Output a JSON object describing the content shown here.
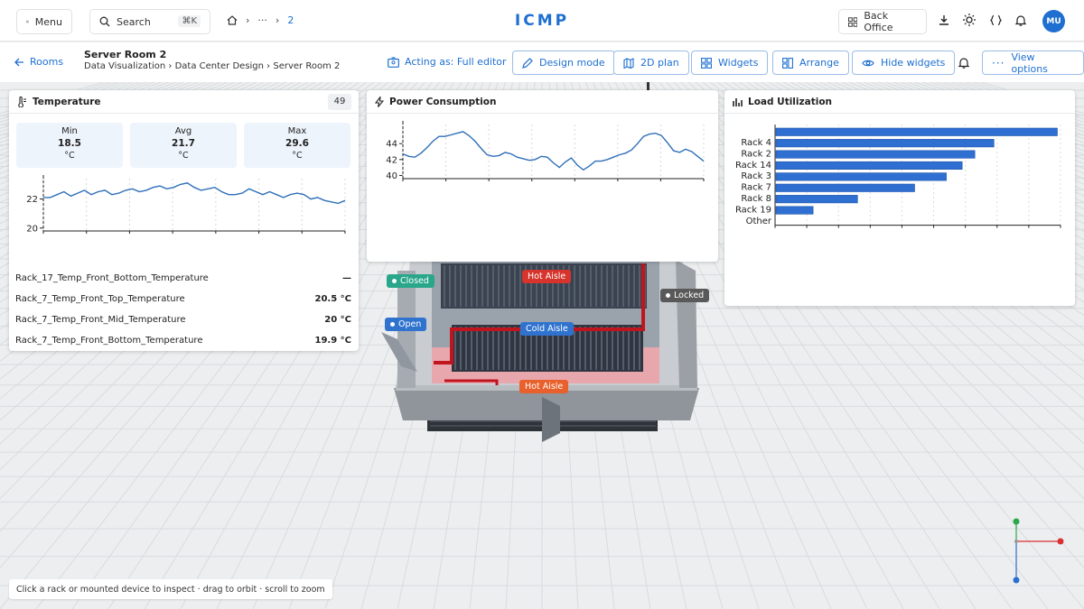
{
  "topbar": {
    "menu_label": "Menu",
    "search_label": "Search",
    "search_shortcut": "⌘K",
    "breadcrumb_ellipsis": "···",
    "breadcrumb_current": "2",
    "brand": "ICMP",
    "back_office_label": "Back Office",
    "avatar_initials": "MU"
  },
  "subheader": {
    "back_label": "Rooms",
    "room_title": "Server Room 2",
    "breadcrumb": "Data Visualization › Data Center Design › Server Room 2",
    "acting_as": "Acting as: Full editor",
    "buttons": {
      "design_mode": "Design mode",
      "plan_2d": "2D plan",
      "widgets": "Widgets",
      "arrange": "Arrange",
      "hide_widgets": "Hide widgets",
      "view_options": "View options"
    }
  },
  "temperature": {
    "title": "Temperature",
    "badge": "49",
    "stats": [
      {
        "label": "Min",
        "value": "18.5",
        "unit": "°C"
      },
      {
        "label": "Avg",
        "value": "21.7",
        "unit": "°C"
      },
      {
        "label": "Max",
        "value": "29.6",
        "unit": "°C"
      }
    ],
    "rows": [
      {
        "name": "Rack_17_Temp_Front_Bottom_Temperature",
        "value": "—"
      },
      {
        "name": "Rack_7_Temp_Front_Top_Temperature",
        "value": "20.5 °C"
      },
      {
        "name": "Rack_7_Temp_Front_Mid_Temperature",
        "value": "20 °C"
      },
      {
        "name": "Rack_7_Temp_Front_Bottom_Temperature",
        "value": "19.9 °C"
      }
    ]
  },
  "power": {
    "title": "Power Consumption"
  },
  "load": {
    "title": "Load Utilization"
  },
  "chart_data": [
    {
      "type": "line",
      "yticks": [
        20,
        22
      ],
      "ylim": [
        19.8,
        23.4
      ],
      "values": [
        22.1,
        22.1,
        22.3,
        22.5,
        22.2,
        22.4,
        22.6,
        22.3,
        22.5,
        22.6,
        22.3,
        22.4,
        22.6,
        22.7,
        22.5,
        22.6,
        22.8,
        22.9,
        22.7,
        22.8,
        23.0,
        23.1,
        22.8,
        22.6,
        22.7,
        22.8,
        22.5,
        22.3,
        22.3,
        22.4,
        22.7,
        22.5,
        22.3,
        22.5,
        22.3,
        22.1,
        22.3,
        22.4,
        22.3,
        22.0,
        22.1,
        21.9,
        21.8,
        21.7,
        21.9
      ],
      "color": "#2f6fb8"
    },
    {
      "type": "line",
      "yticks": [
        40,
        42,
        44
      ],
      "ylim": [
        39.6,
        46.4
      ],
      "values": [
        42.7,
        42.4,
        42.3,
        42.8,
        43.5,
        44.3,
        44.9,
        44.9,
        45.1,
        45.3,
        45.5,
        45.0,
        44.3,
        43.4,
        42.6,
        42.4,
        42.5,
        42.9,
        42.7,
        42.3,
        42.1,
        41.9,
        42.0,
        42.4,
        42.3,
        41.6,
        41.0,
        41.7,
        42.2,
        41.3,
        40.7,
        41.2,
        41.8,
        41.8,
        42.0,
        42.3,
        42.6,
        42.8,
        43.2,
        44.0,
        44.9,
        45.2,
        45.3,
        45.0,
        44.1,
        43.1,
        42.9,
        43.3,
        43.0,
        42.4,
        41.8
      ]
    },
    {
      "type": "bar",
      "orientation": "horizontal",
      "categories": [
        "Rack 4",
        "Rack 2",
        "Rack 14",
        "Rack 3",
        "Rack 7",
        "Rack 8",
        "Rack 19",
        "Other"
      ],
      "values": [
        89,
        69,
        63,
        59,
        54,
        44,
        26,
        12
      ],
      "xlim": [
        0,
        90
      ],
      "color": "#2f6fd1"
    }
  ],
  "scene": {
    "tags": {
      "hot_aisle_top": "Hot Aisle",
      "cold_aisle": "Cold Aisle",
      "hot_aisle_bottom": "Hot Aisle",
      "closed": "Closed",
      "open": "Open",
      "locked": "Locked"
    },
    "hint": "Click a rack or mounted device to inspect · drag to orbit · scroll to zoom"
  },
  "colors": {
    "accent": "#1e6fd0",
    "hot": "#d6342c",
    "cold": "#2f73cf",
    "open_closed": "#2aa78a",
    "locked": "#595959"
  }
}
